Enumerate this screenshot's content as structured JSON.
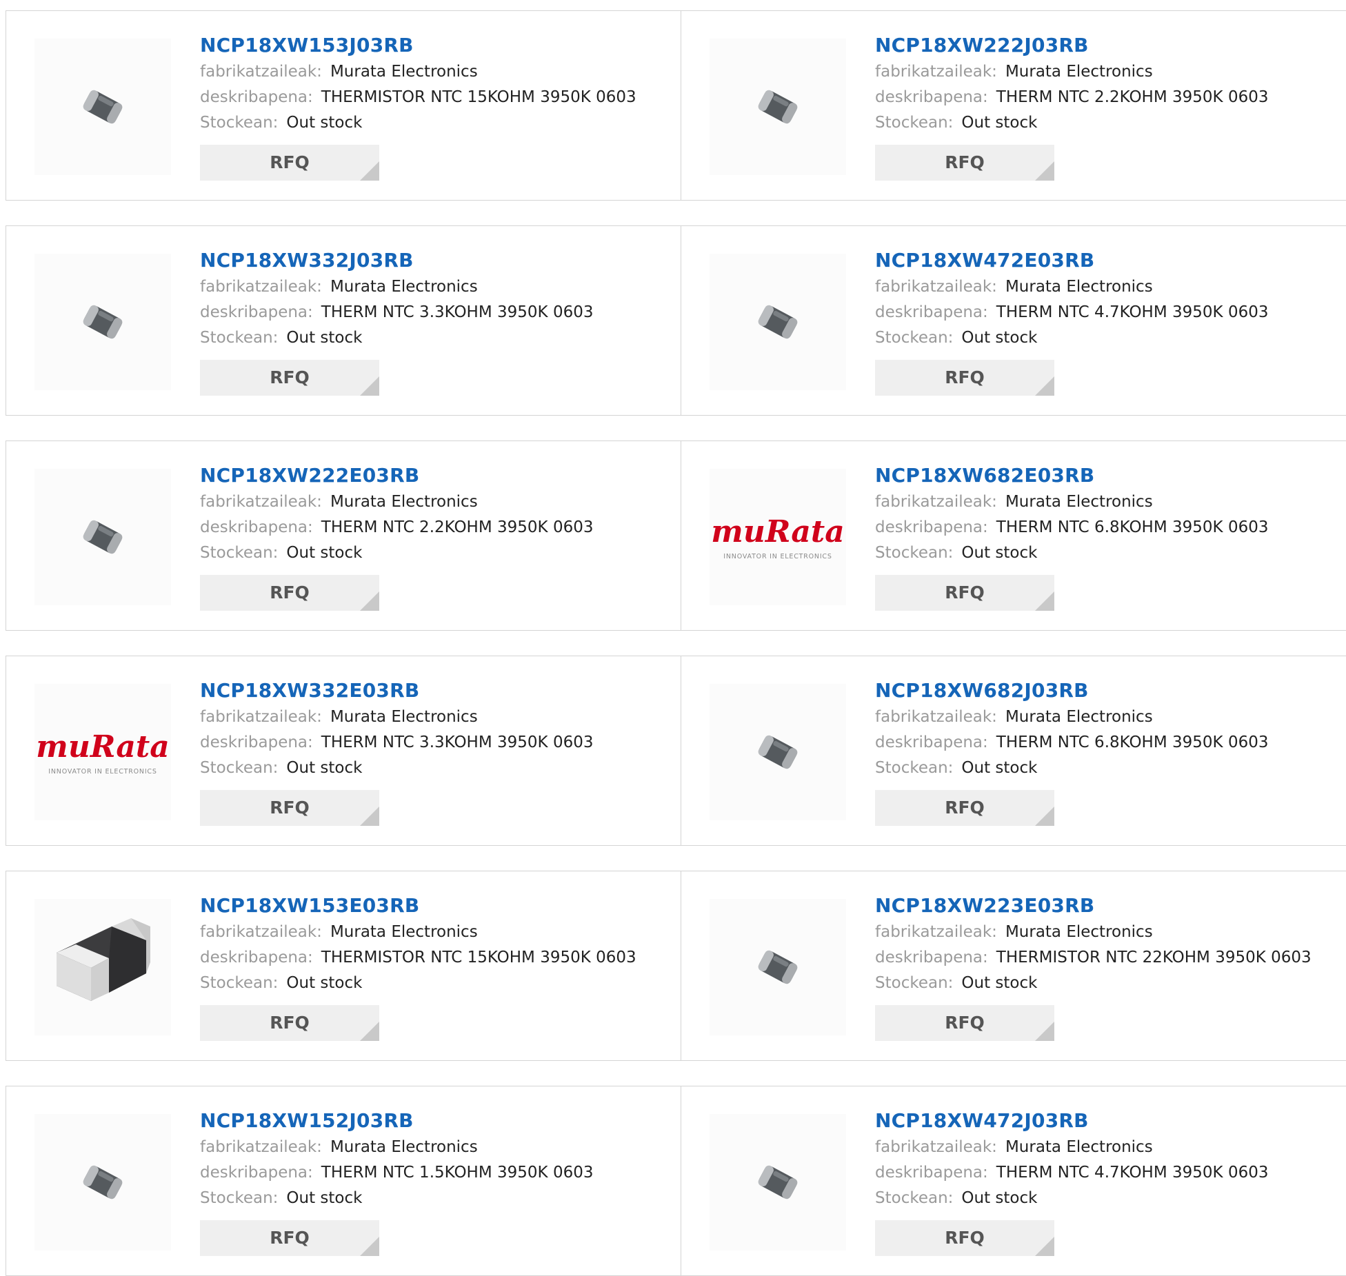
{
  "labels": {
    "manufacturer": "fabrikatzaileak:",
    "description": "deskribapena:",
    "stock": "Stockean:",
    "rfq": "RFQ"
  },
  "brand_logo": {
    "name": "muRata",
    "tagline": "INNOVATOR IN ELECTRONICS",
    "color": "#d0021b"
  },
  "colors": {
    "part_link": "#1565b8",
    "label": "#9a9a9a",
    "value": "#222222",
    "button_bg": "#efefef"
  },
  "products": [
    {
      "part": "NCP18XW153J03RB",
      "manufacturer": "Murata Electronics",
      "description": "THERMISTOR NTC 15KOHM 3950K 0603",
      "stock": "Out stock",
      "image": "chip-small"
    },
    {
      "part": "NCP18XW222J03RB",
      "manufacturer": "Murata Electronics",
      "description": "THERM NTC 2.2KOHM 3950K 0603",
      "stock": "Out stock",
      "image": "chip-small"
    },
    {
      "part": "NCP18XW332J03RB",
      "manufacturer": "Murata Electronics",
      "description": "THERM NTC 3.3KOHM 3950K 0603",
      "stock": "Out stock",
      "image": "chip-small"
    },
    {
      "part": "NCP18XW472E03RB",
      "manufacturer": "Murata Electronics",
      "description": "THERM NTC 4.7KOHM 3950K 0603",
      "stock": "Out stock",
      "image": "chip-small"
    },
    {
      "part": "NCP18XW222E03RB",
      "manufacturer": "Murata Electronics",
      "description": "THERM NTC 2.2KOHM 3950K 0603",
      "stock": "Out stock",
      "image": "chip-small"
    },
    {
      "part": "NCP18XW682E03RB",
      "manufacturer": "Murata Electronics",
      "description": "THERM NTC 6.8KOHM 3950K 0603",
      "stock": "Out stock",
      "image": "murata-logo"
    },
    {
      "part": "NCP18XW332E03RB",
      "manufacturer": "Murata Electronics",
      "description": "THERM NTC 3.3KOHM 3950K 0603",
      "stock": "Out stock",
      "image": "murata-logo"
    },
    {
      "part": "NCP18XW682J03RB",
      "manufacturer": "Murata Electronics",
      "description": "THERM NTC 6.8KOHM 3950K 0603",
      "stock": "Out stock",
      "image": "chip-small"
    },
    {
      "part": "NCP18XW153E03RB",
      "manufacturer": "Murata Electronics",
      "description": "THERMISTOR NTC 15KOHM 3950K 0603",
      "stock": "Out stock",
      "image": "chip-large"
    },
    {
      "part": "NCP18XW223E03RB",
      "manufacturer": "Murata Electronics",
      "description": "THERMISTOR NTC 22KOHM 3950K 0603",
      "stock": "Out stock",
      "image": "chip-small"
    },
    {
      "part": "NCP18XW152J03RB",
      "manufacturer": "Murata Electronics",
      "description": "THERM NTC 1.5KOHM 3950K 0603",
      "stock": "Out stock",
      "image": "chip-small"
    },
    {
      "part": "NCP18XW472J03RB",
      "manufacturer": "Murata Electronics",
      "description": "THERM NTC 4.7KOHM 3950K 0603",
      "stock": "Out stock",
      "image": "chip-small"
    }
  ]
}
